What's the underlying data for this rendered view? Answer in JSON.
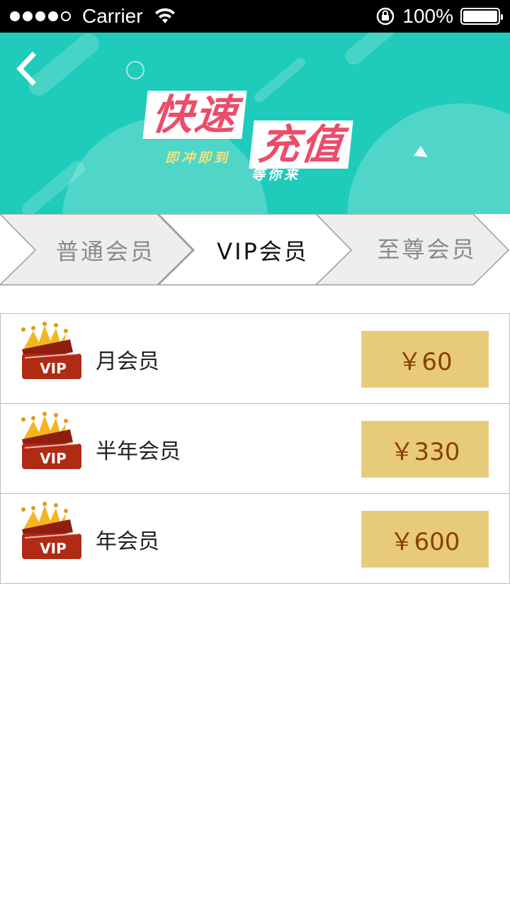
{
  "status_bar": {
    "carrier": "Carrier",
    "battery_percent": "100%"
  },
  "banner": {
    "title_line1": "快速",
    "title_line2": "充值",
    "subtitle1": "即冲即到",
    "subtitle2": "等你来",
    "colors": {
      "background": "#1fcbba",
      "title": "#ec4c6a",
      "subtitle1": "#f3e07a"
    }
  },
  "tabs": {
    "items": [
      {
        "label": "普通会员",
        "active": false
      },
      {
        "label": "VIP会员",
        "active": true
      },
      {
        "label": "至尊会员",
        "active": false
      }
    ]
  },
  "plans": {
    "icon_text": "VIP",
    "items": [
      {
        "name": "月会员",
        "price": "￥60"
      },
      {
        "name": "半年会员",
        "price": "￥330"
      },
      {
        "name": "年会员",
        "price": "￥600"
      }
    ],
    "colors": {
      "price_bg": "#e8cb7a",
      "price_text": "#8a3f05"
    }
  }
}
